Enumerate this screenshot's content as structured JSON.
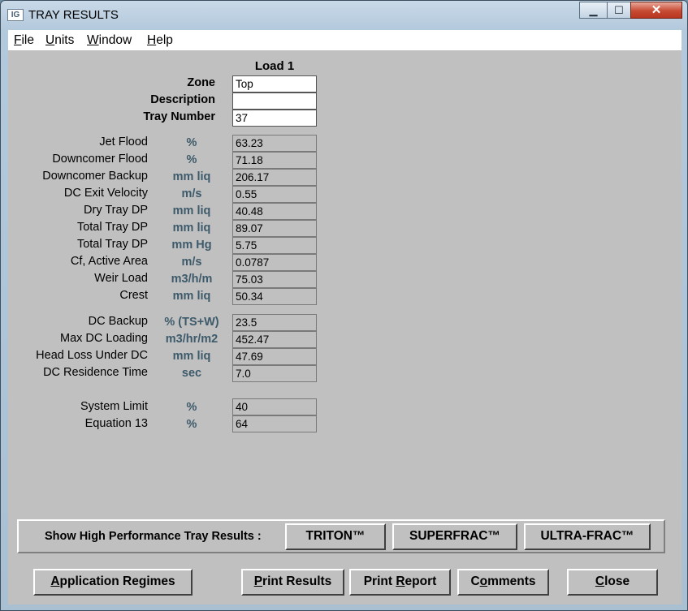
{
  "window": {
    "title": "TRAY RESULTS",
    "icon": "ig-app-icon",
    "icon_text": "IG"
  },
  "menu": [
    {
      "prefix": "",
      "key": "F",
      "rest": "ile"
    },
    {
      "prefix": "",
      "key": "U",
      "rest": "nits"
    },
    {
      "prefix": "",
      "key": "W",
      "rest": "indow"
    },
    {
      "prefix": "",
      "key": "H",
      "rest": "elp"
    }
  ],
  "header": {
    "load": "Load 1",
    "zone_label": "Zone",
    "zone": "Top",
    "description_label": "Description",
    "description": "",
    "tray_number_label": "Tray Number",
    "tray_number": "37"
  },
  "group1": [
    {
      "label": "Jet Flood",
      "unit": "%",
      "value": "63.23"
    },
    {
      "label": "Downcomer Flood",
      "unit": "%",
      "value": "71.18"
    },
    {
      "label": "Downcomer Backup",
      "unit": "mm liq",
      "value": "206.17"
    },
    {
      "label": "DC Exit Velocity",
      "unit": "m/s",
      "value": "0.55"
    },
    {
      "label": "Dry Tray DP",
      "unit": "mm liq",
      "value": "40.48"
    },
    {
      "label": "Total Tray DP",
      "unit": "mm liq",
      "value": "89.07"
    },
    {
      "label": "Total Tray DP",
      "unit": "mm Hg",
      "value": "5.75"
    },
    {
      "label": "Cf, Active Area",
      "unit": "m/s",
      "value": "0.0787"
    },
    {
      "label": "Weir Load",
      "unit": "m3/h/m",
      "value": "75.03"
    },
    {
      "label": "Crest",
      "unit": "mm liq",
      "value": "50.34"
    }
  ],
  "group2": [
    {
      "label": "DC Backup",
      "unit": "% (TS+W)",
      "value": "23.5"
    },
    {
      "label": "Max DC Loading",
      "unit": "m3/hr/m2",
      "value": "452.47"
    },
    {
      "label": "Head Loss Under DC",
      "unit": "mm liq",
      "value": "47.69"
    },
    {
      "label": "DC Residence Time",
      "unit": "sec",
      "value": "7.0"
    }
  ],
  "group3": [
    {
      "label": "System Limit",
      "unit": "%",
      "value": "40"
    },
    {
      "label": "Equation 13",
      "unit": "%",
      "value": "64"
    }
  ],
  "high_performance": {
    "label": "Show High Performance Tray Results :",
    "buttons": [
      "TRITON™",
      "SUPERFRAC™",
      "ULTRA-FRAC™"
    ]
  },
  "bottom_buttons": [
    {
      "prefix": "",
      "key": "A",
      "rest": "pplication Regimes"
    },
    {
      "prefix": "",
      "key": "P",
      "rest": "rint Results"
    },
    {
      "prefix": "Print ",
      "key": "R",
      "rest": "eport"
    },
    {
      "prefix": "C",
      "key": "o",
      "rest": "mments"
    },
    {
      "prefix": "",
      "key": "C",
      "rest": "lose"
    }
  ]
}
